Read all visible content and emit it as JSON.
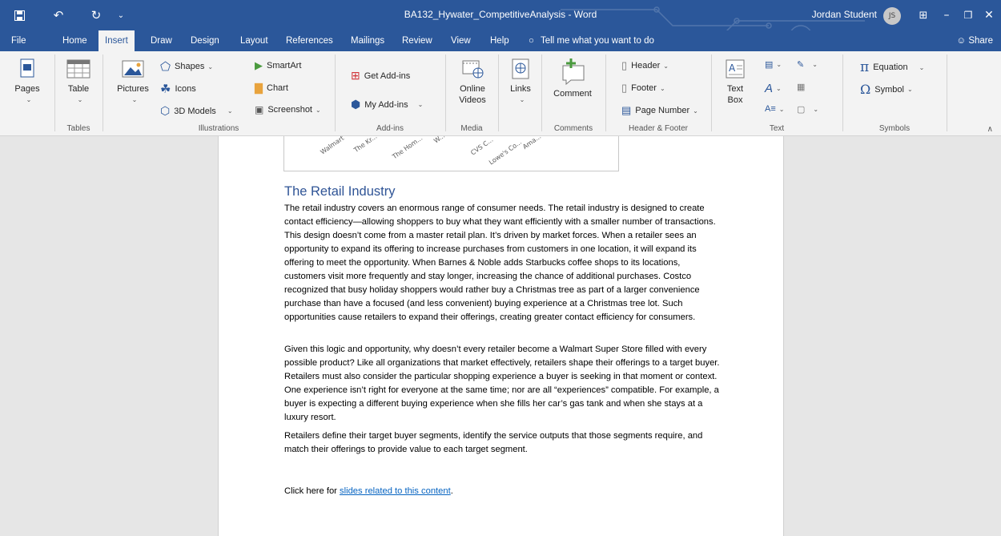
{
  "window": {
    "title": "BA132_Hywater_CompetitiveAnalysis  -  Word",
    "user_name": "Jordan Student",
    "user_initials": "JS"
  },
  "menu": {
    "tabs": [
      "File",
      "Home",
      "Insert",
      "Draw",
      "Design",
      "Layout",
      "References",
      "Mailings",
      "Review",
      "View",
      "Help"
    ],
    "active_tab": "Insert",
    "tell_me": "Tell me what you want to do",
    "share": "Share"
  },
  "ribbon": {
    "pages": "Pages",
    "tables_group": "Tables",
    "table": "Table",
    "illustrations_group": "Illustrations",
    "pictures": "Pictures",
    "shapes": "Shapes",
    "icons": "Icons",
    "models_3d": "3D Models",
    "smartart": "SmartArt",
    "chart": "Chart",
    "screenshot": "Screenshot",
    "addins_group": "Add-ins",
    "get_addins": "Get Add-ins",
    "my_addins": "My Add-ins",
    "media_group": "Media",
    "online_videos_1": "Online",
    "online_videos_2": "Videos",
    "links": "Links",
    "comments_group": "Comments",
    "comment": "Comment",
    "header_footer_group": "Header & Footer",
    "header": "Header",
    "footer": "Footer",
    "page_number": "Page Number",
    "text_group": "Text",
    "text_box_1": "Text",
    "text_box_2": "Box",
    "symbols_group": "Symbols",
    "equation": "Equation",
    "symbol": "Symbol"
  },
  "chart_ticks": [
    "Walmart",
    "The Kr...",
    "The Hom...",
    "W...",
    "CVS C...",
    "Lowe's Co...",
    "Ama..."
  ],
  "document": {
    "heading": "The Retail Industry",
    "paragraph1": "The retail industry covers an enormous range of consumer needs. The retail industry is designed to create contact efficiency—allowing shoppers to buy what they want efficiently with a smaller number of transactions. This design doesn’t come from a master retail plan. It’s driven by market forces. When a retailer sees an opportunity to expand its offering to increase purchases from customers in one location, it will expand its offering to meet the opportunity. When Barnes & Noble adds Starbucks coffee shops to its locations, customers visit more frequently and stay longer, increasing the chance of additional purchases. Costco recognized that busy holiday shoppers would rather buy a Christmas tree as part of a larger convenience purchase than have a focused (and less convenient) buying experience at a Christmas tree lot. Such opportunities cause retailers to expand their offerings, creating greater contact efficiency for consumers.",
    "paragraph2": "Given this logic and opportunity, why doesn’t every retailer become a Walmart Super Store filled with every possible product? Like all organizations that market effectively, retailers shape their offerings to a target buyer. Retailers must also consider the particular shopping experience a buyer is seeking in that moment or context. One experience isn’t right for everyone at the same time; nor are all “experiences” compatible. For example, a buyer is expecting a different buying experience when she fills her car’s gas tank and when she stays at a luxury resort.",
    "paragraph3": "Retailers define their target buyer segments, identify the service outputs that those segments require, and match their offerings to provide value to each target segment.",
    "click_prefix": "Click here for ",
    "click_link": "slides related to this content",
    "click_suffix": "."
  }
}
